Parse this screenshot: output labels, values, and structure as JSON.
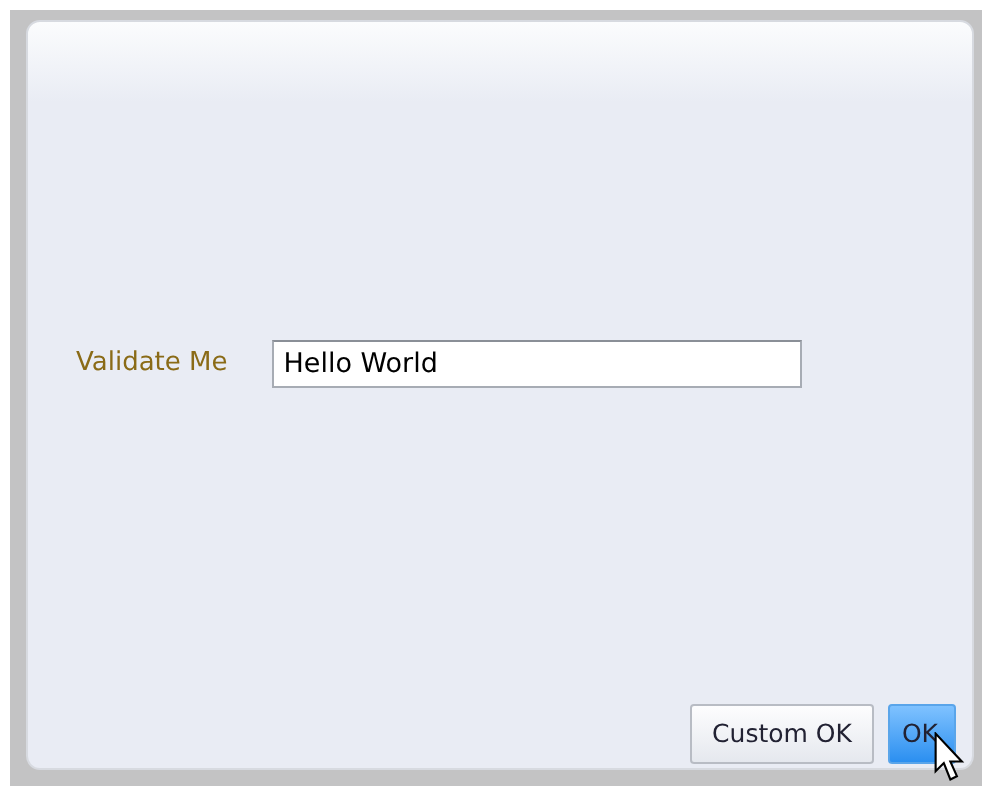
{
  "form": {
    "label": "Validate Me",
    "value": "Hello World"
  },
  "buttons": [
    {
      "label": "Custom OK",
      "hovered": false
    },
    {
      "label": "OK",
      "hovered": true
    }
  ]
}
